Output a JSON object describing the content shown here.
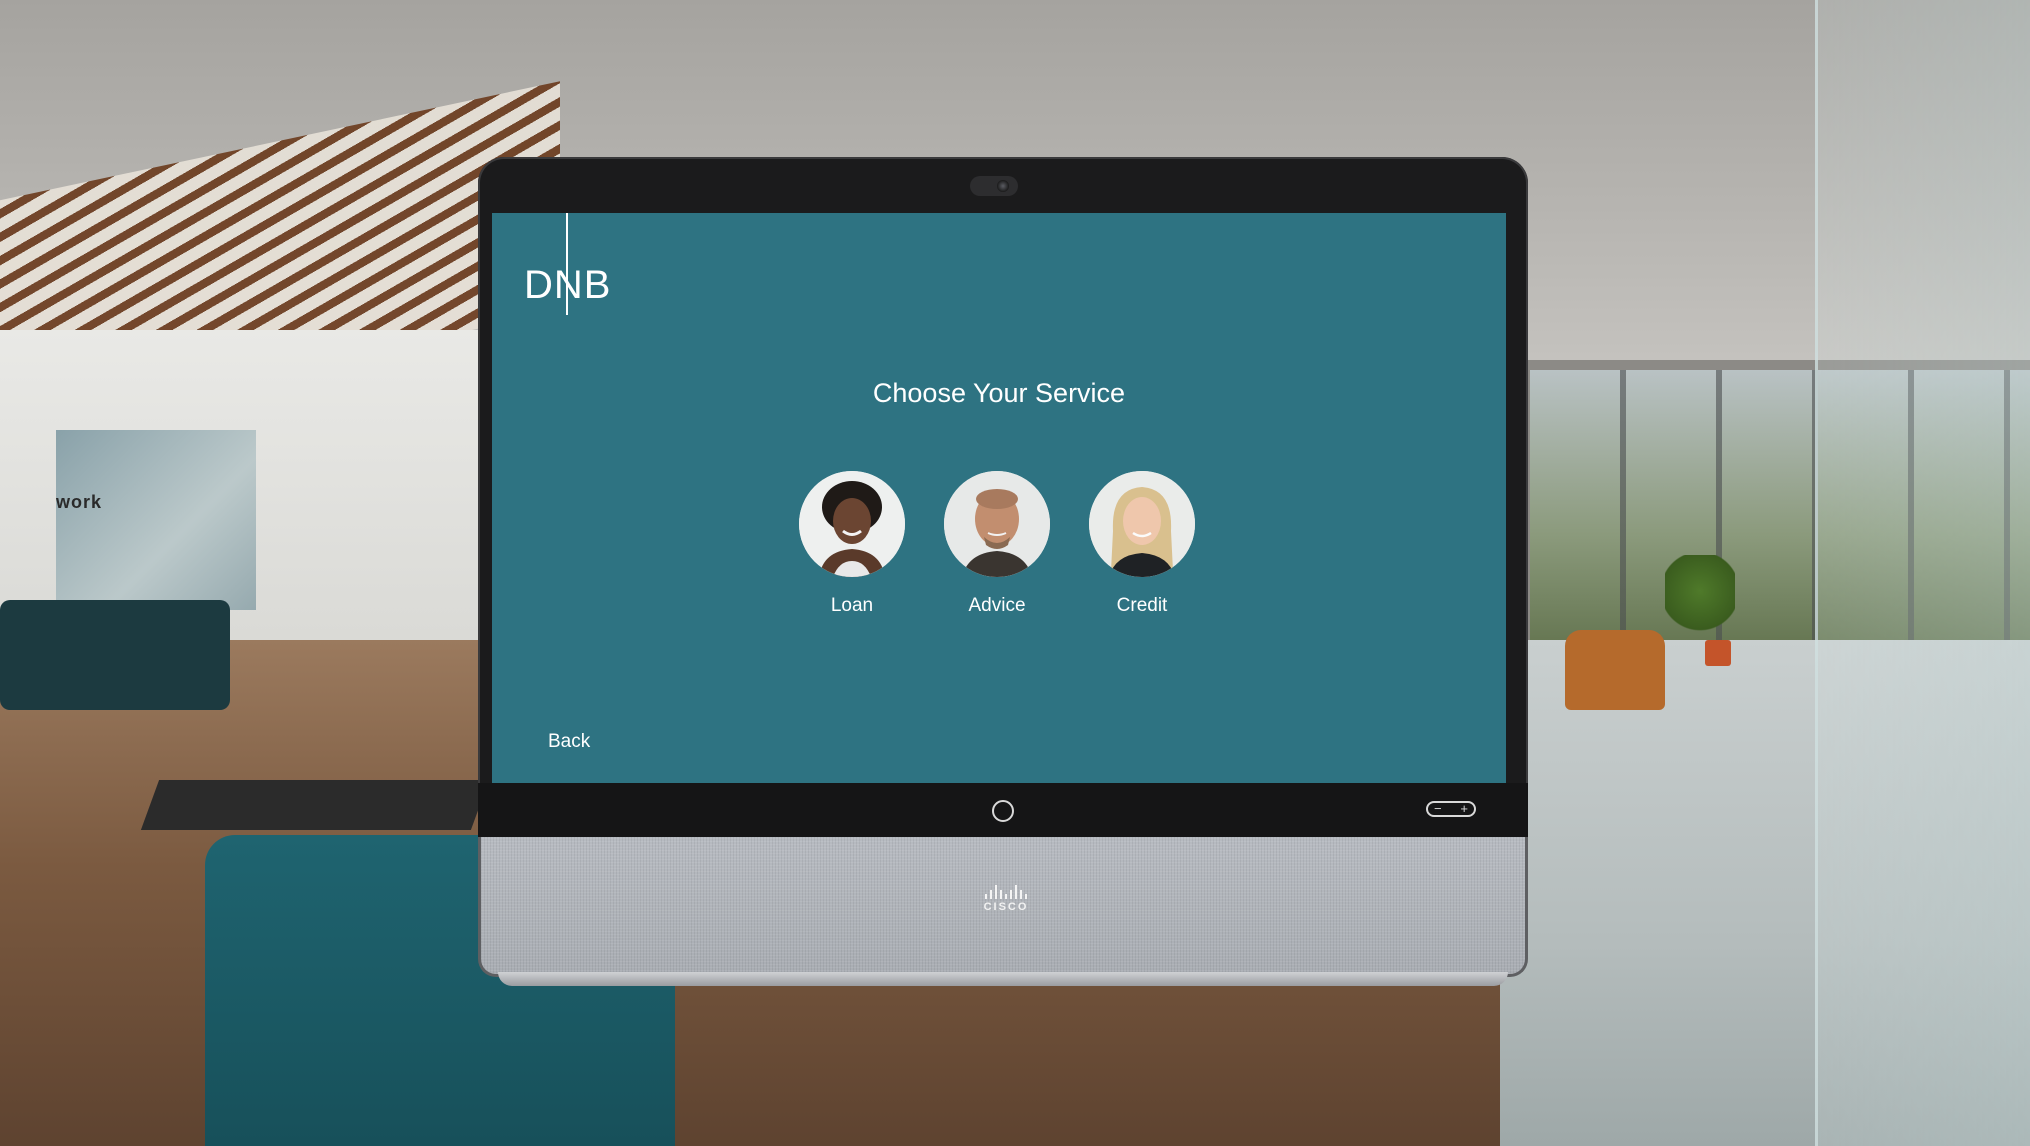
{
  "background": {
    "wall_sign": "work"
  },
  "screen": {
    "logo": "DNB",
    "title": "Choose Your Service",
    "services": [
      {
        "label": "Loan",
        "icon": "person-avatar-icon"
      },
      {
        "label": "Advice",
        "icon": "person-avatar-icon"
      },
      {
        "label": "Credit",
        "icon": "person-avatar-icon"
      }
    ],
    "back_label": "Back"
  },
  "device": {
    "brand": "CISCO",
    "volume_minus": "−",
    "volume_plus": "+"
  },
  "colors": {
    "screen_background": "#2e7382",
    "text": "#ffffff",
    "bezel": "#1b1b1c"
  }
}
